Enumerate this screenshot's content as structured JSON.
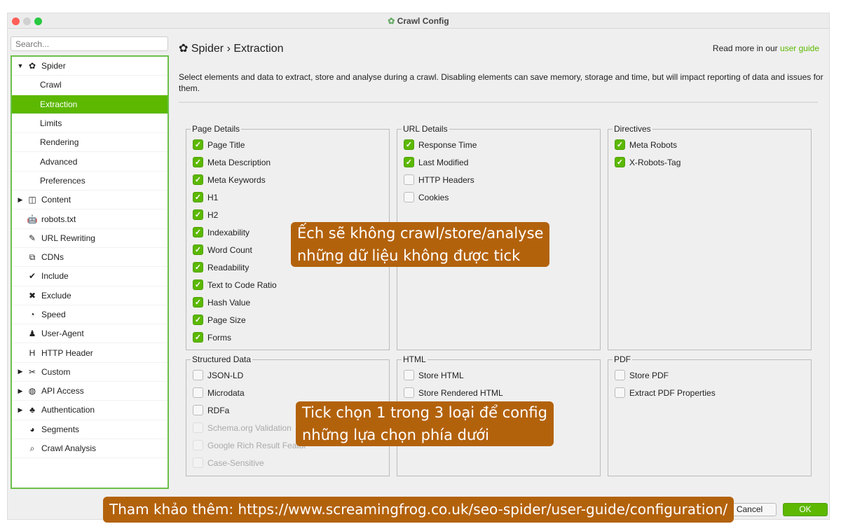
{
  "window": {
    "title": "Crawl Config"
  },
  "sidebar": {
    "search_placeholder": "Search...",
    "items": [
      {
        "label": "Spider",
        "icon": "gear-icon",
        "glyph": "✿",
        "arrow": "▼"
      },
      {
        "label": "Crawl",
        "sub": true
      },
      {
        "label": "Extraction",
        "sub": true,
        "selected": true
      },
      {
        "label": "Limits",
        "sub": true
      },
      {
        "label": "Rendering",
        "sub": true
      },
      {
        "label": "Advanced",
        "sub": true
      },
      {
        "label": "Preferences",
        "sub": true
      },
      {
        "label": "Content",
        "icon": "columns-icon",
        "glyph": "◫",
        "arrow": "▶"
      },
      {
        "label": "robots.txt",
        "icon": "robot-icon",
        "glyph": "🤖"
      },
      {
        "label": "URL Rewriting",
        "icon": "edit-icon",
        "glyph": "✎"
      },
      {
        "label": "CDNs",
        "icon": "network-icon",
        "glyph": "⧉"
      },
      {
        "label": "Include",
        "icon": "check-circle-icon",
        "glyph": "✔"
      },
      {
        "label": "Exclude",
        "icon": "x-circle-icon",
        "glyph": "✖"
      },
      {
        "label": "Speed",
        "icon": "gauge-icon",
        "glyph": "◔"
      },
      {
        "label": "User-Agent",
        "icon": "user-secret-icon",
        "glyph": "♟"
      },
      {
        "label": "HTTP Header",
        "icon": "header-icon",
        "glyph": "H"
      },
      {
        "label": "Custom",
        "icon": "tools-icon",
        "glyph": "✂",
        "arrow": "▶"
      },
      {
        "label": "API Access",
        "icon": "globe-icon",
        "glyph": "◍",
        "arrow": "▶"
      },
      {
        "label": "Authentication",
        "icon": "users-lock-icon",
        "glyph": "♣",
        "arrow": "▶"
      },
      {
        "label": "Segments",
        "icon": "pie-chart-icon",
        "glyph": "◕"
      },
      {
        "label": "Crawl Analysis",
        "icon": "search-icon",
        "glyph": "⌕"
      }
    ]
  },
  "main": {
    "crumb_root": "Spider",
    "crumb_sep": "›",
    "crumb_page": "Extraction",
    "guide_prefix": "Read more in our ",
    "guide_link": "user guide",
    "description": "Select elements and data to extract, store and analyse during a crawl. Disabling elements can save memory, storage and time, but will impact reporting of data and issues for them.",
    "panels": [
      {
        "title": "Page Details",
        "items": [
          {
            "label": "Page Title",
            "checked": true
          },
          {
            "label": "Meta Description",
            "checked": true
          },
          {
            "label": "Meta Keywords",
            "checked": true
          },
          {
            "label": "H1",
            "checked": true
          },
          {
            "label": "H2",
            "checked": true
          },
          {
            "label": "Indexability",
            "checked": true
          },
          {
            "label": "Word Count",
            "checked": true
          },
          {
            "label": "Readability",
            "checked": true
          },
          {
            "label": "Text to Code Ratio",
            "checked": true
          },
          {
            "label": "Hash Value",
            "checked": true
          },
          {
            "label": "Page Size",
            "checked": true
          },
          {
            "label": "Forms",
            "checked": true
          }
        ]
      },
      {
        "title": "URL Details",
        "items": [
          {
            "label": "Response Time",
            "checked": true
          },
          {
            "label": "Last Modified",
            "checked": true
          },
          {
            "label": "HTTP Headers",
            "checked": false
          },
          {
            "label": "Cookies",
            "checked": false
          }
        ]
      },
      {
        "title": "Directives",
        "items": [
          {
            "label": "Meta Robots",
            "checked": true
          },
          {
            "label": "X-Robots-Tag",
            "checked": true
          }
        ]
      },
      {
        "title": "Structured Data",
        "items": [
          {
            "label": "JSON-LD",
            "checked": false
          },
          {
            "label": "Microdata",
            "checked": false
          },
          {
            "label": "RDFa",
            "checked": false
          },
          {
            "label": "Schema.org Validation",
            "checked": false,
            "disabled": true
          },
          {
            "label": "Google Rich Result Featur",
            "checked": false,
            "disabled": true
          },
          {
            "label": "Case-Sensitive",
            "checked": false,
            "disabled": true
          }
        ]
      },
      {
        "title": "HTML",
        "items": [
          {
            "label": "Store HTML",
            "checked": false
          },
          {
            "label": "Store Rendered HTML",
            "checked": false
          }
        ]
      },
      {
        "title": "PDF",
        "items": [
          {
            "label": "Store PDF",
            "checked": false
          },
          {
            "label": "Extract PDF Properties",
            "checked": false
          }
        ]
      }
    ]
  },
  "footer": {
    "cancel": "Cancel",
    "ok": "OK"
  },
  "annotations": [
    "Ếch sẽ không crawl/store/analyse\nnhững dữ liệu không được tick",
    "Tick chọn 1 trong 3 loại để config\nnhững lựa chọn phía dưới",
    "Tham khảo thêm: https://www.screamingfrog.co.uk/seo-spider/user-guide/configuration/"
  ],
  "colors": {
    "accent": "#5cb800",
    "annotation": "#b3620c"
  }
}
